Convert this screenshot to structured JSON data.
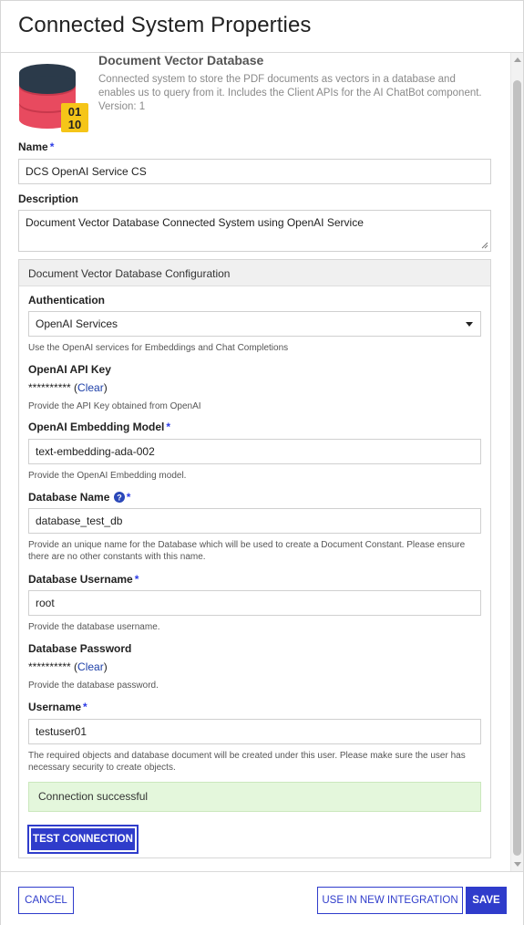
{
  "dialog": {
    "title": "Connected System Properties"
  },
  "intro": {
    "title": "Document Vector Database",
    "description": "Connected system to store the PDF documents as vectors in a database and enables us to query from it. Includes the Client APIs for the AI ChatBot component.",
    "version": "Version: 1",
    "logo_text_top": "01",
    "logo_text_bottom": "10"
  },
  "name": {
    "label": "Name",
    "required": "*",
    "value": "DCS OpenAI Service CS"
  },
  "description": {
    "label": "Description",
    "value": "Document Vector Database Connected System using OpenAI Service"
  },
  "config": {
    "heading": "Document Vector Database Configuration",
    "authentication": {
      "label": "Authentication",
      "value": "OpenAI Services",
      "help": "Use the OpenAI services for Embeddings and Chat Completions"
    },
    "api_key": {
      "label": "OpenAI API Key",
      "masked": "**********",
      "clear_open": " (",
      "clear_label": "Clear",
      "clear_close": ")",
      "help": "Provide the API Key obtained from OpenAI"
    },
    "embedding_model": {
      "label": "OpenAI Embedding Model",
      "required": "*",
      "value": "text-embedding-ada-002",
      "help": "Provide the OpenAI Embedding model."
    },
    "database_name": {
      "label": "Database Name",
      "required": "*",
      "value": "database_test_db",
      "help": "Provide an unique name for the Database which will be used to create a Document Constant. Please ensure there are no other constants with this name."
    },
    "database_username": {
      "label": "Database Username",
      "required": "*",
      "value": "root",
      "help": "Provide the database username."
    },
    "database_password": {
      "label": "Database Password",
      "masked": "**********",
      "clear_open": " (",
      "clear_label": "Clear",
      "clear_close": ")",
      "help": "Provide the database password."
    },
    "username": {
      "label": "Username",
      "required": "*",
      "value": "testuser01",
      "help": "The required objects and database document will be created under this user. Please make sure the user has necessary security to create objects."
    },
    "status_message": "Connection successful",
    "test_button": "TEST CONNECTION"
  },
  "footer": {
    "cancel": "CANCEL",
    "use_in_integration": "USE IN NEW INTEGRATION",
    "save": "SAVE"
  },
  "colors": {
    "accent": "#2f3ccb",
    "success_bg": "#e4f7dc",
    "required": "#2d3ce6",
    "logo_red": "#e84a5f",
    "logo_dark": "#2b3a4a",
    "logo_yellow": "#f5c518"
  },
  "icons": [
    "database-logo-icon",
    "help-circle-icon",
    "dropdown-arrow-icon",
    "resize-grip-icon"
  ]
}
